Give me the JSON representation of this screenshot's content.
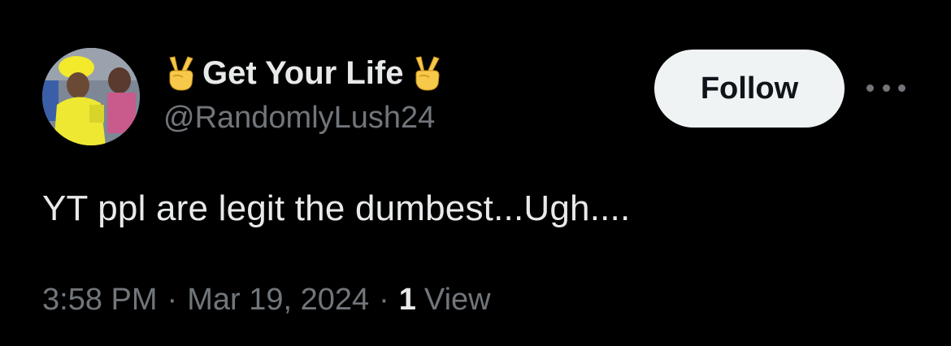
{
  "tweet": {
    "author": {
      "display_name": "Get Your Life",
      "handle": "@RandomlyLush24",
      "avatar_icon": "avatar-photo",
      "name_emoji": "victory-hand-icon"
    },
    "follow_label": "Follow",
    "more_icon": "more-options-icon",
    "text": "YT ppl are legit the dumbest...Ugh....",
    "time": "3:58 PM",
    "separator": "·",
    "date": "Mar 19, 2024",
    "views_count": "1",
    "views_label": "View"
  },
  "colors": {
    "background": "#000000",
    "primary_text": "#e7e9ea",
    "secondary_text": "#71767b",
    "follow_bg": "#eff3f4",
    "follow_text": "#0f1419",
    "emoji_yellow": "#f7c94b"
  }
}
